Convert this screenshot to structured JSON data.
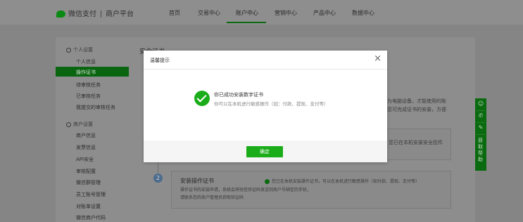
{
  "header": {
    "brand": "微信支付",
    "platform": "商户平台",
    "nav": [
      "首页",
      "交易中心",
      "账户中心",
      "营销中心",
      "产品中心",
      "数据中心"
    ],
    "active_nav": "账户中心"
  },
  "sidebar": {
    "section1_title": "个人设置",
    "section1_items": [
      "个人信息",
      "操作证书",
      "待审核任务",
      "已审核任务",
      "我提交的审核任务"
    ],
    "active_item": "操作证书",
    "section2_title": "商户设置",
    "section2_items": [
      "商户信息",
      "发票信息",
      "API安全",
      "审核配置",
      "微信群管理",
      "员工账号管理",
      "对账单设置",
      "微信商户代码"
    ]
  },
  "page": {
    "title": "安全证书",
    "bg_right_text1": "为电脑设备，才能使用的账",
    "bg_right_text2": "您可完成证书的安装，方便",
    "bg_box1_text": "您已在本机安装安全控件",
    "step_number": "2",
    "step_title": "安装操作证书",
    "step_status": "您已在本机安装操作证书，可以在本机进行敏感操作（如付款、提现、支付等）",
    "step_desc1": "操作证书的安装申请，系统会将短信验证码发送到商户号绑定的手机，",
    "step_desc2": "请联系您的商户管理员获取验证码"
  },
  "float_bar": {
    "icons": [
      "chat-icon",
      "phone-icon",
      "edit-icon"
    ],
    "label": "获取帮助"
  },
  "dialog": {
    "title": "温馨提示",
    "close": "×",
    "message_title": "你已成功安装数字证书",
    "message_sub": "你可以在本机进行敏感操作（如：付款、提现、支付等）",
    "confirm_label": "确定",
    "accent_color": "#1aad19"
  }
}
